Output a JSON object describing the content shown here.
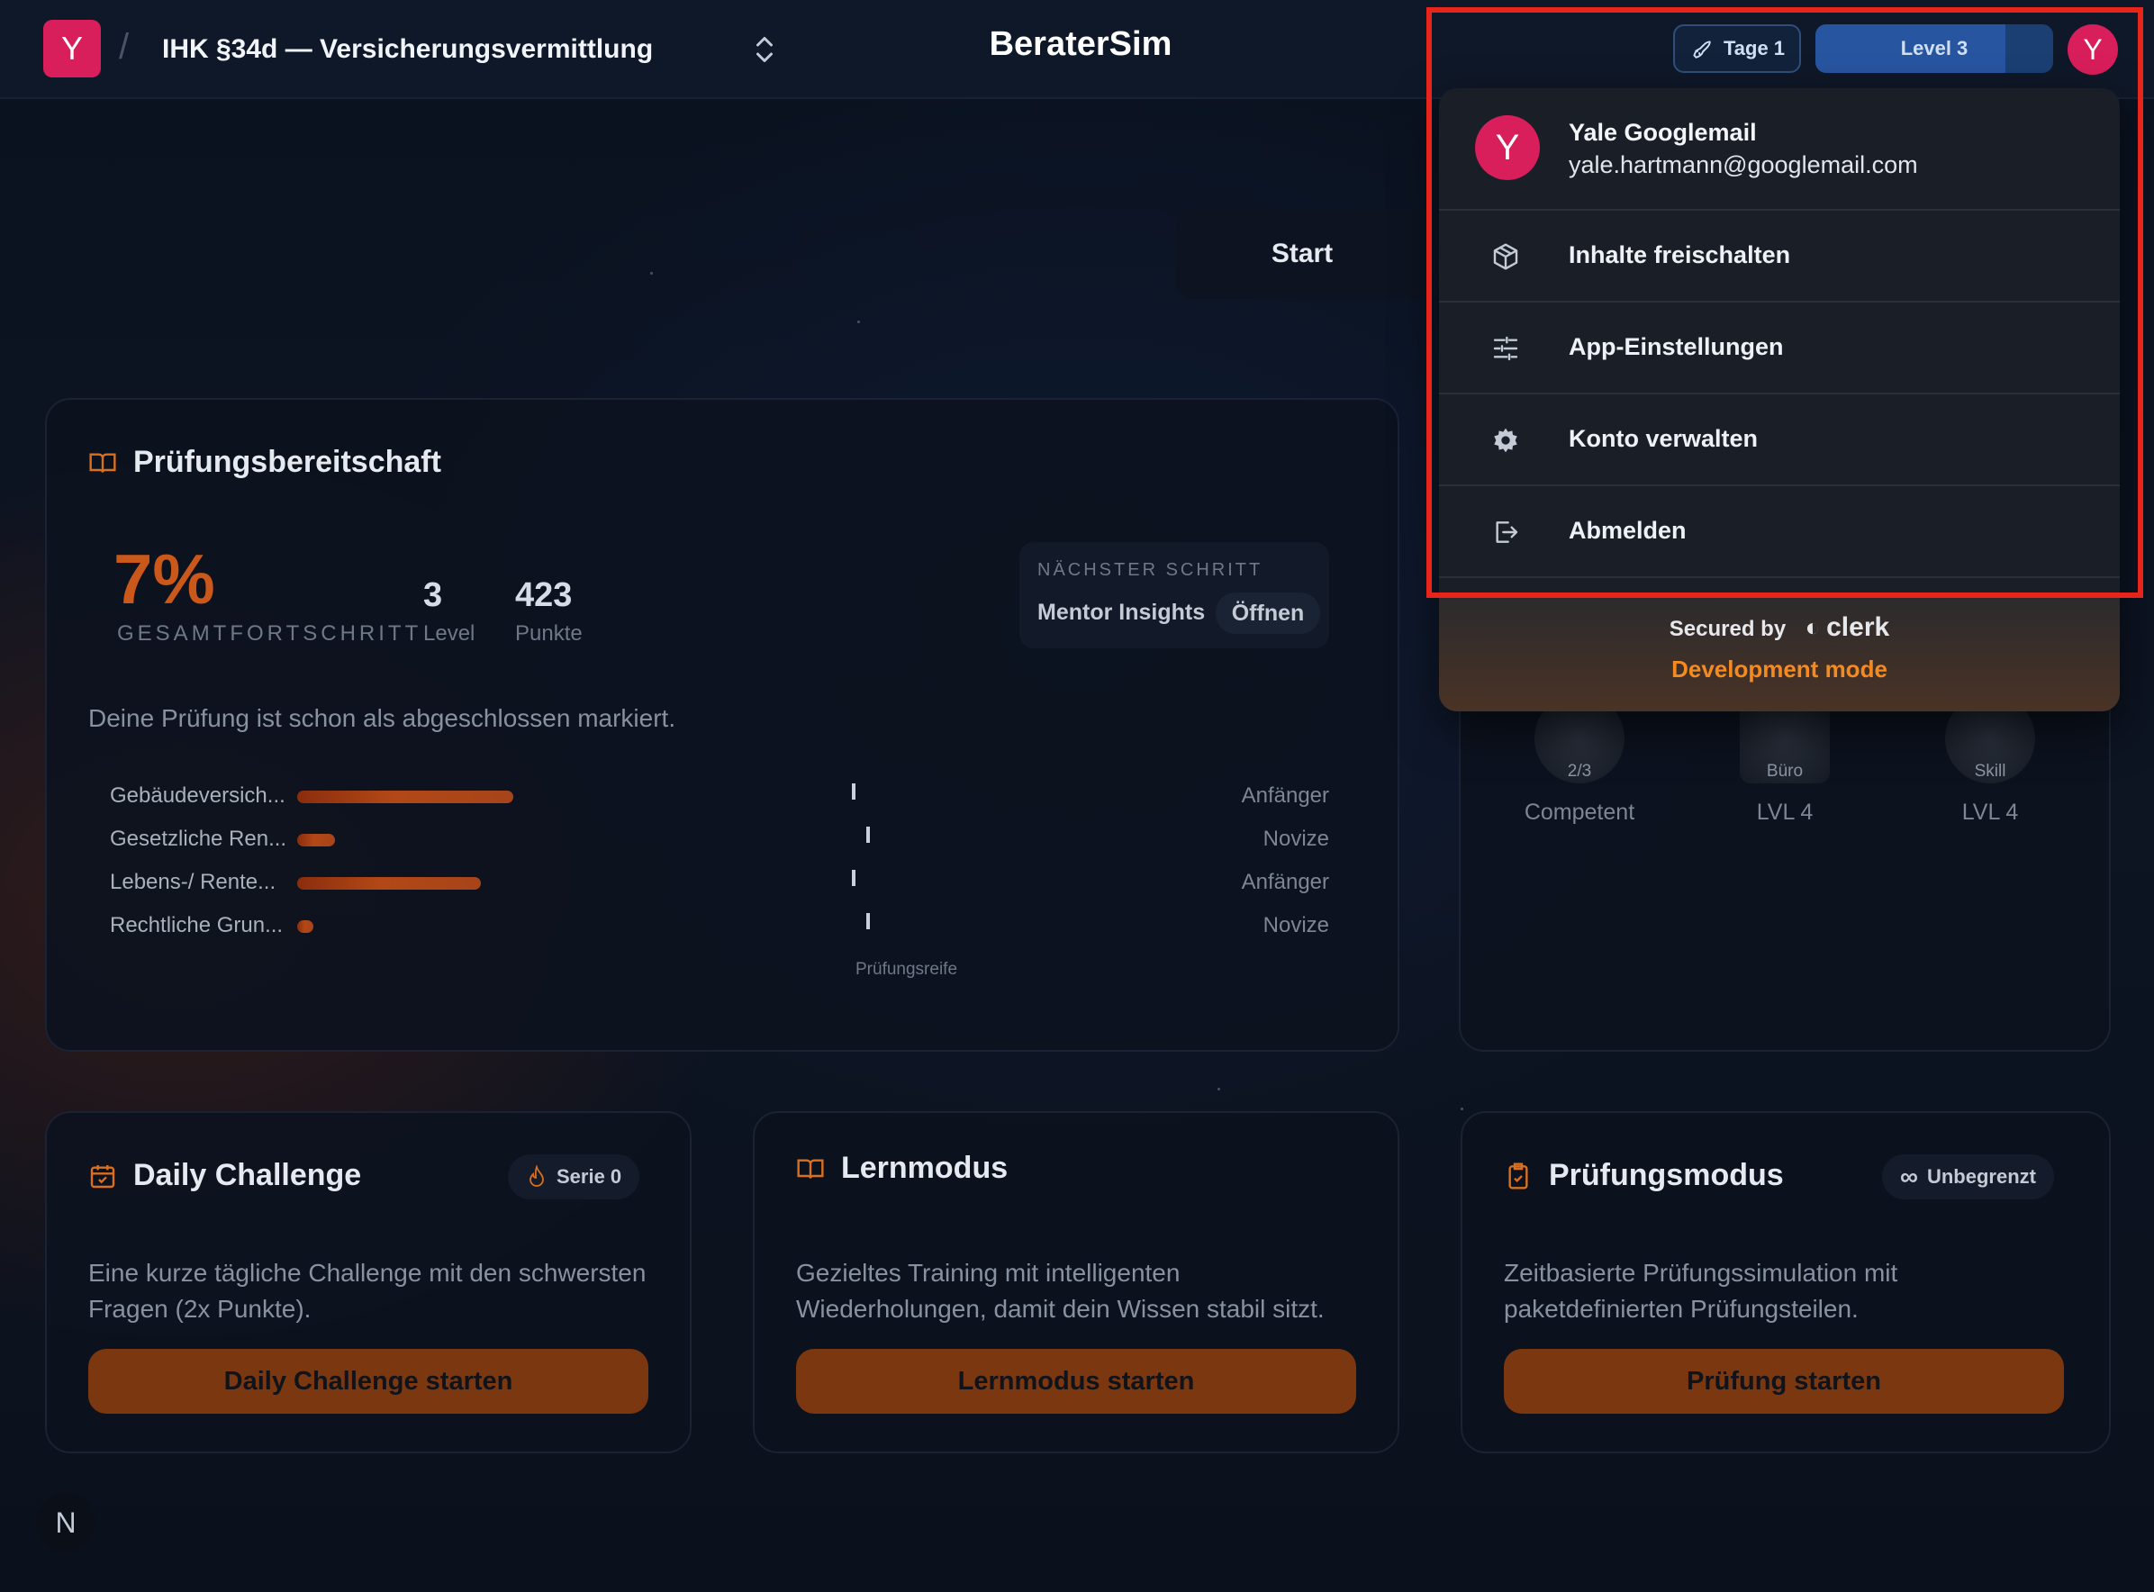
{
  "header": {
    "logo_letter": "Y",
    "separator": "/",
    "project": "IHK §34d — Versicherungsvermittlung",
    "app_title": "BeraterSim",
    "tage_chip": "Tage 1",
    "level_chip": "Level 3",
    "level_progress": 0.8,
    "avatar_letter": "Y"
  },
  "nav": {
    "start_tab": "Start"
  },
  "readiness": {
    "title": "Prüfungsbereitschaft",
    "percent": "7%",
    "percent_label": "GESAMTFORTSCHRITT",
    "level_value": "3",
    "level_label": "Level",
    "points_value": "423",
    "points_label": "Punkte",
    "next_step_label": "NÄCHSTER SCHRITT",
    "next_step_value": "Mentor Insights",
    "next_step_button": "Öffnen",
    "completed_text": "Deine Prüfung ist schon als abgeschlossen markiert.",
    "exam_ready_label": "Prüfungsreife",
    "topics": [
      {
        "name": "Gebäudeversich...",
        "progress": 0.4,
        "level": "Anfänger"
      },
      {
        "name": "Gesetzliche Ren...",
        "progress": 0.07,
        "level": "Novize"
      },
      {
        "name": "Lebens-/ Rente...",
        "progress": 0.34,
        "level": "Anfänger"
      },
      {
        "name": "Rechtliche Grun...",
        "progress": 0.02,
        "level": "Novize"
      }
    ]
  },
  "badges": [
    {
      "inner": "2/3",
      "label": "Competent"
    },
    {
      "inner": "Büro",
      "label": "LVL 4"
    },
    {
      "inner": "Skill",
      "label": "LVL 4"
    }
  ],
  "daily": {
    "title": "Daily Challenge",
    "streak": "Serie 0",
    "desc": "Eine kurze tägliche Challenge mit den schwersten Fragen (2x Punkte).",
    "button": "Daily Challenge starten"
  },
  "learn": {
    "title": "Lernmodus",
    "desc": "Gezieltes Training mit intelligenten Wiederholungen, damit dein Wissen stabil sitzt.",
    "button": "Lernmodus starten"
  },
  "exam": {
    "title": "Prüfungsmodus",
    "chip": "Unbegrenzt",
    "desc": "Zeitbasierte Prüfungssimulation mit paketdefinierten Prüfungsteilen.",
    "button": "Prüfung starten"
  },
  "dev_badge": "N",
  "user_menu": {
    "avatar_letter": "Y",
    "name": "Yale Googlemail",
    "email": "yale.hartmann@googlemail.com",
    "items": [
      {
        "label": "Inhalte freischalten",
        "icon": "package-icon"
      },
      {
        "label": "App-Einstellungen",
        "icon": "sliders-icon"
      },
      {
        "label": "Konto verwalten",
        "icon": "gear-icon"
      },
      {
        "label": "Abmelden",
        "icon": "sign-out-icon"
      }
    ],
    "secured_by": "Secured by",
    "clerk": "clerk",
    "dev_mode": "Development mode"
  },
  "colors": {
    "accent": "#d81e5b",
    "orange": "#c9581a",
    "highlight": "#e8251a",
    "dev_mode": "#f58a1f"
  }
}
